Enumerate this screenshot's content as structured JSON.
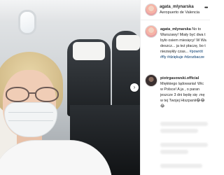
{
  "post": {
    "author": "agata_mlynarska",
    "location": "Aeropuerto de Valencia"
  },
  "caption": {
    "author": "agata_mlynarska",
    "lines": [
      "No to",
      "Warszawy! Miały być dwa t",
      "było osiem miesięcy! W Wa",
      "deszcz... ja też płaczę, bo t",
      "niezwykły czas... "
    ],
    "tag_line_end": "#powrót",
    "hashtags": "#fly #dziękuje #dzozbacze"
  },
  "reply": {
    "author": "piotrgasowski.official",
    "lines": [
      "Miękkiego lądowania! Wic",
      "w Polsce! A ja , o paran",
      "jeszcze 3 dni będę się .mę",
      "w tej Twojej Hiszpanii",
      "😂"
    ],
    "emoji_tail": "😂😂"
  },
  "icons": {
    "more": "more-options-icon",
    "next": "chevron-right-icon"
  },
  "glyphs": {
    "more": "•••",
    "next": "›"
  }
}
